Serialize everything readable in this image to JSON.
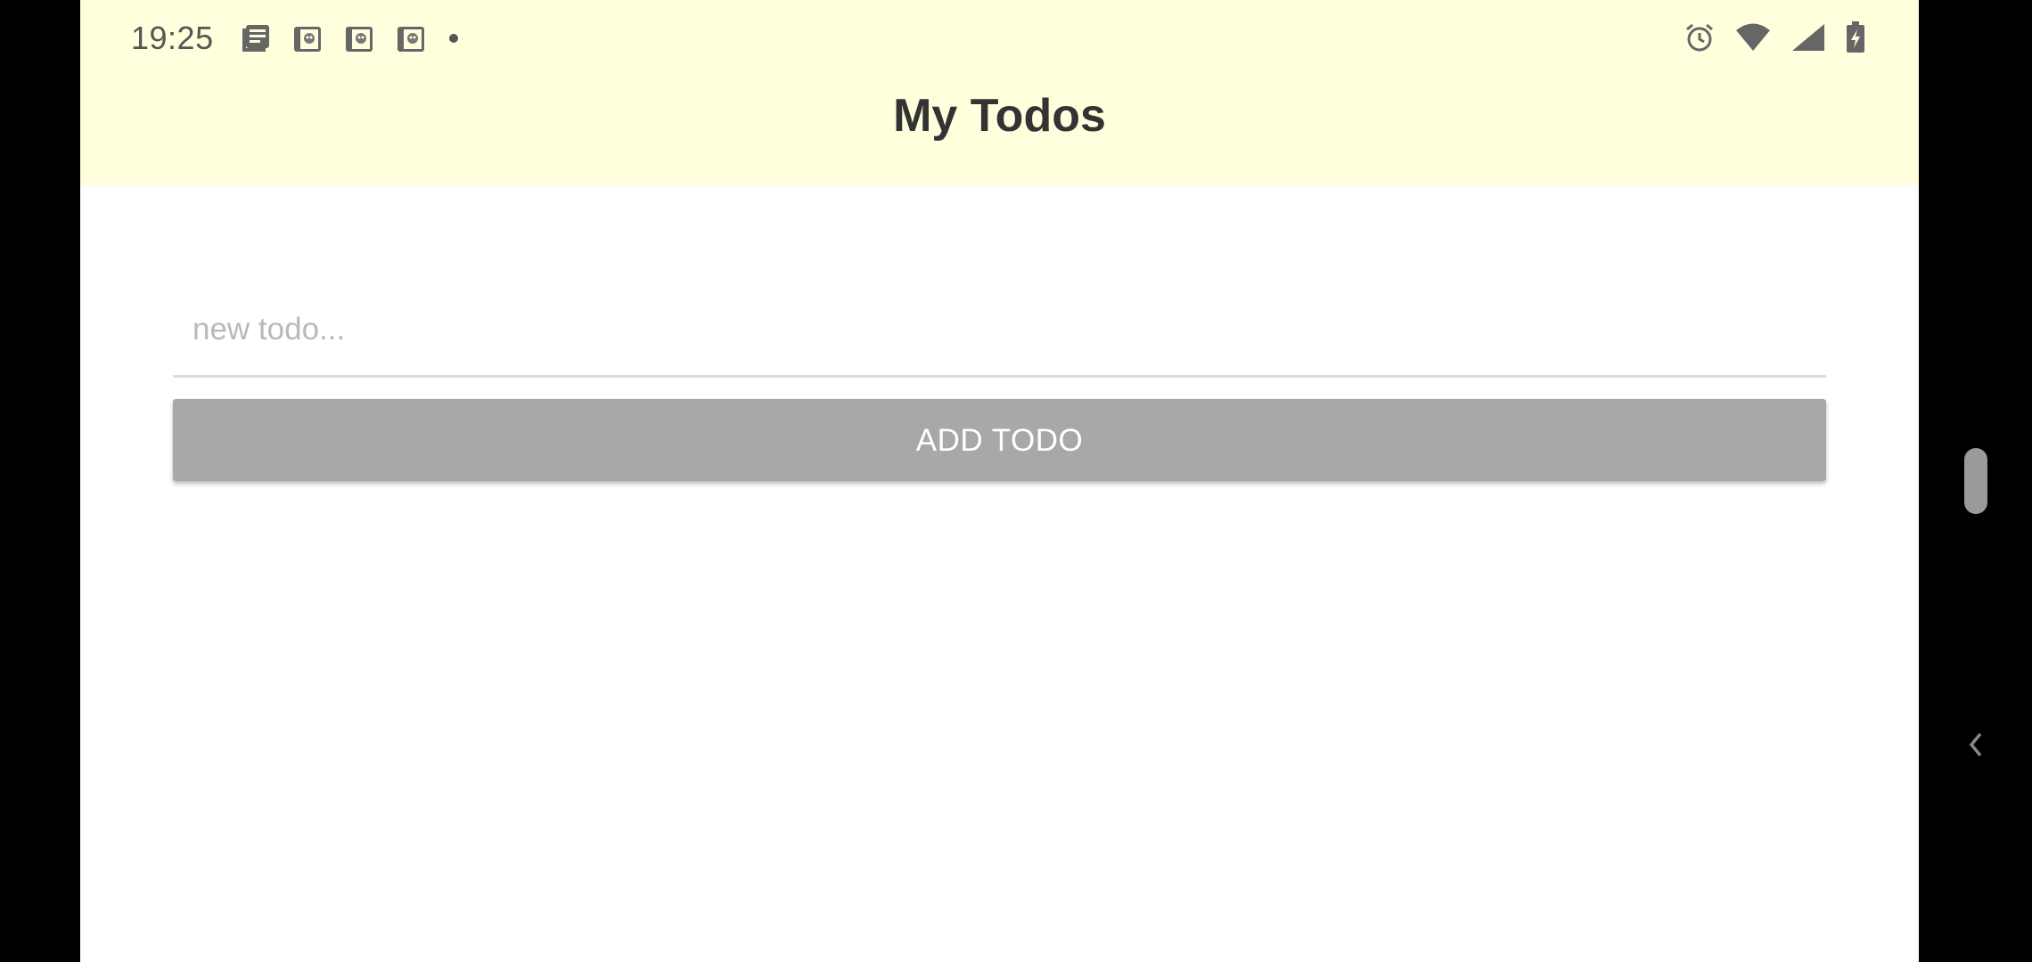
{
  "status_bar": {
    "time": "19:25",
    "left_icons": [
      "news-icon",
      "app-notification-icon",
      "app-notification-icon",
      "app-notification-icon",
      "more-notifications-dot-icon"
    ],
    "right_icons": [
      "alarm-icon",
      "wifi-icon",
      "cellular-signal-icon",
      "battery-charging-icon"
    ]
  },
  "header": {
    "title": "My Todos",
    "background": "#ffffde"
  },
  "todo_form": {
    "input_placeholder": "new todo...",
    "input_value": "",
    "add_button_label": "ADD TODO",
    "add_button_color": "#a8a8a8"
  },
  "system_ui": {
    "scroll_handle": "scroll-handle",
    "back_icon": "chevron-left-icon"
  }
}
